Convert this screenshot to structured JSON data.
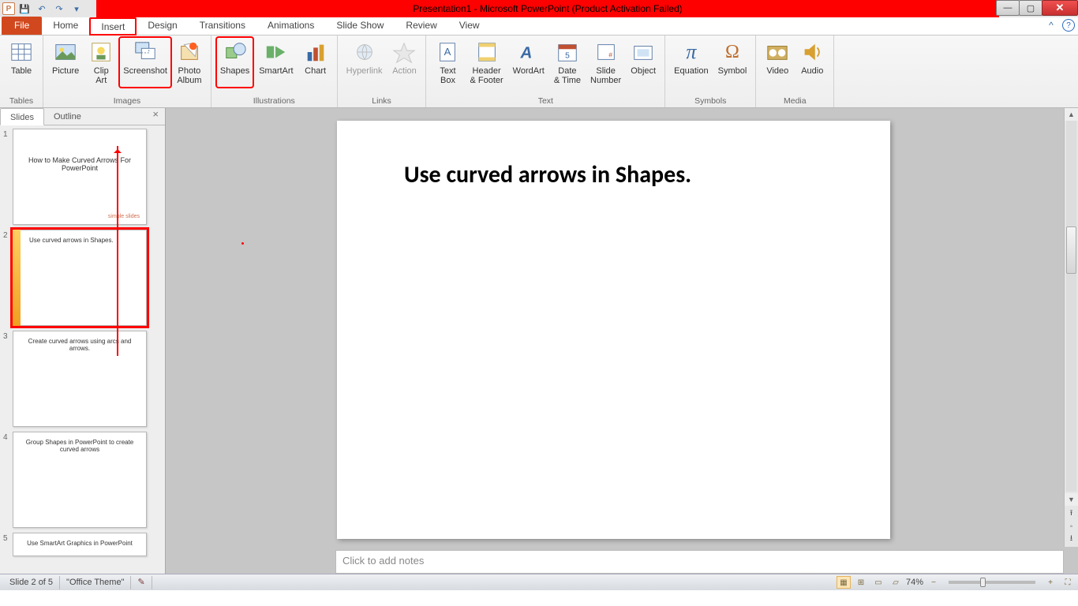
{
  "titlebar": {
    "title": "Presentation1 - Microsoft PowerPoint (Product Activation Failed)"
  },
  "tabs": {
    "file": "File",
    "home": "Home",
    "insert": "Insert",
    "design": "Design",
    "transitions": "Transitions",
    "animations": "Animations",
    "slideshow": "Slide Show",
    "review": "Review",
    "view": "View"
  },
  "ribbon": {
    "tables": {
      "table": "Table",
      "label": "Tables"
    },
    "images": {
      "picture": "Picture",
      "clipart": "Clip\nArt",
      "screenshot": "Screenshot",
      "photoalbum": "Photo\nAlbum",
      "label": "Images"
    },
    "illus": {
      "shapes": "Shapes",
      "smartart": "SmartArt",
      "chart": "Chart",
      "label": "Illustrations"
    },
    "links": {
      "hyperlink": "Hyperlink",
      "action": "Action",
      "label": "Links"
    },
    "text": {
      "textbox": "Text\nBox",
      "header": "Header\n& Footer",
      "wordart": "WordArt",
      "datetime": "Date\n& Time",
      "slidenum": "Slide\nNumber",
      "object": "Object",
      "label": "Text"
    },
    "symbols": {
      "equation": "Equation",
      "symbol": "Symbol",
      "label": "Symbols"
    },
    "media": {
      "video": "Video",
      "audio": "Audio",
      "label": "Media"
    }
  },
  "leftpanel": {
    "slides": "Slides",
    "outline": "Outline",
    "thumbs": [
      {
        "n": "1",
        "title": "How to Make Curved Arrows For PowerPoint",
        "logo": "simple slides"
      },
      {
        "n": "2",
        "title": "Use curved arrows in Shapes."
      },
      {
        "n": "3",
        "title": "Create curved arrows using arcs and arrows."
      },
      {
        "n": "4",
        "title": "Group Shapes in PowerPoint to create curved arrows"
      },
      {
        "n": "5",
        "title": "Use SmartArt Graphics in PowerPoint"
      }
    ]
  },
  "canvas": {
    "title": "Use curved arrows in Shapes."
  },
  "notes": {
    "placeholder": "Click to add notes"
  },
  "status": {
    "slide": "Slide 2 of 5",
    "theme": "\"Office Theme\"",
    "zoom": "74%"
  }
}
